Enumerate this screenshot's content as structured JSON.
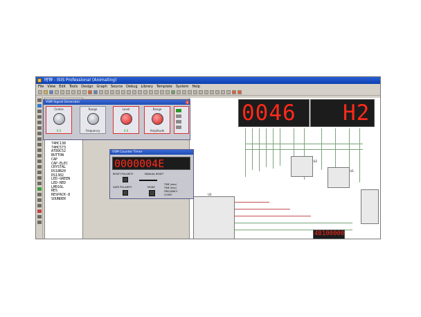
{
  "window": {
    "title": "时钟 - ISIS Professional (Animating)"
  },
  "menu": [
    "File",
    "View",
    "Edit",
    "Tools",
    "Design",
    "Graph",
    "Source",
    "Debug",
    "Library",
    "Template",
    "System",
    "Help"
  ],
  "device_list": [
    "74HC138",
    "74HC573",
    "AT89C52",
    "BUTTON",
    "CAP",
    "CAP-ELEC",
    "CRYSTAL",
    "DS18B20",
    "DS1302",
    "LED-GREEN",
    "LED-RED",
    "LM016L",
    "RES",
    "RESPACK-8",
    "SOUNDER"
  ],
  "signal_generator": {
    "title": "VSM Signal Generator",
    "knobs": [
      "Centre",
      "Range",
      "Level",
      "Range"
    ],
    "labels": [
      "",
      "Frequency",
      "",
      "Amplitude"
    ],
    "readouts": [
      "0.0",
      "",
      "0.0",
      ""
    ]
  },
  "counter_timer": {
    "title": "VSM Counter Timer",
    "display": "0000004E",
    "labels": {
      "reset_polarity": "RESET POLARITY",
      "manual_reset": "MANUAL RESET",
      "gate_polarity": "GATE POLARITY",
      "mode": "MODE"
    },
    "modes": [
      "TIME (secs)",
      "TIME (hms)",
      "FREQUENCY",
      "COUNT"
    ]
  },
  "seven_seg_display": {
    "left": "0046",
    "right": "H2"
  },
  "small_display": "48100000",
  "chips": {
    "u2": "U2",
    "u1": "U1",
    "u3": "U3"
  }
}
